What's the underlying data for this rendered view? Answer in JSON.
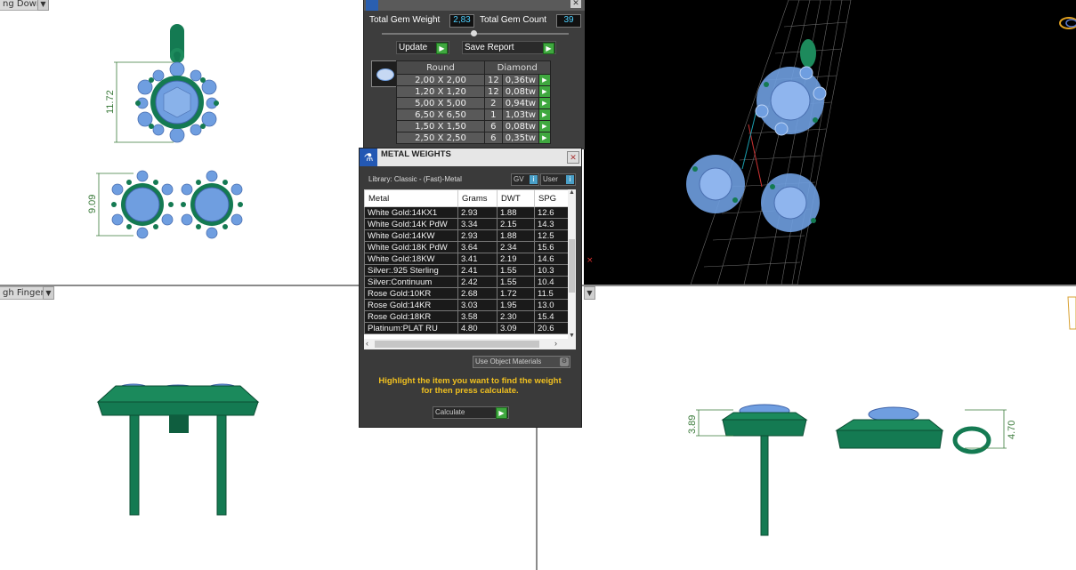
{
  "viewports": {
    "top_left_label": "ng Down",
    "bottom_left_label": "gh Finger"
  },
  "dimensions": {
    "pendant_height": "11.72",
    "earring_height": "9.09",
    "earring_side_height": "3.89",
    "pendant_side_height": "4.70"
  },
  "gem_reporter": {
    "total_weight_label": "Total Gem Weight",
    "total_weight_value": "2,83",
    "total_count_label": "Total Gem Count",
    "total_count_value": "39",
    "update_label": "Update",
    "save_report_label": "Save Report",
    "shape_header": "Round",
    "type_header": "Diamond",
    "rows": [
      {
        "size": "2,00 X 2,00",
        "count": "12",
        "weight": "0,36tw"
      },
      {
        "size": "1,20 X 1,20",
        "count": "12",
        "weight": "0,08tw"
      },
      {
        "size": "5,00 X 5,00",
        "count": "2",
        "weight": "0,94tw"
      },
      {
        "size": "6,50 X 6,50",
        "count": "1",
        "weight": "1,03tw"
      },
      {
        "size": "1,50 X 1,50",
        "count": "6",
        "weight": "0,08tw"
      },
      {
        "size": "2,50 X 2,50",
        "count": "6",
        "weight": "0,35tw"
      }
    ]
  },
  "metal_weights": {
    "title": "METAL WEIGHTS",
    "library": "Library: Classic - (Fast)-Metal",
    "gv_label": "GV",
    "user_label": "User",
    "columns": [
      "Metal",
      "Grams",
      "DWT",
      "SPG"
    ],
    "rows": [
      [
        "White Gold:14KX1",
        "2.93",
        "1.88",
        "12.6"
      ],
      [
        "White Gold:14K PdW",
        "3.34",
        "2.15",
        "14.3"
      ],
      [
        "White Gold:14KW",
        "2.93",
        "1.88",
        "12.5"
      ],
      [
        "White Gold:18K PdW",
        "3.64",
        "2.34",
        "15.6"
      ],
      [
        "White Gold:18KW",
        "3.41",
        "2.19",
        "14.6"
      ],
      [
        "Silver:.925 Sterling",
        "2.41",
        "1.55",
        "10.3"
      ],
      [
        "Silver:Continuum",
        "2.42",
        "1.55",
        "10.4"
      ],
      [
        "Rose Gold:10KR",
        "2.68",
        "1.72",
        "11.5"
      ],
      [
        "Rose Gold:14KR",
        "3.03",
        "1.95",
        "13.0"
      ],
      [
        "Rose Gold:18KR",
        "3.58",
        "2.30",
        "15.4"
      ],
      [
        "Platinum:PLAT RU",
        "4.80",
        "3.09",
        "20.6"
      ]
    ],
    "use_object_materials": "Use Object Materials",
    "instruction": "Highlight the item you want to find the weight for then press calculate.",
    "calculate_label": "Calculate"
  },
  "colors": {
    "metal": "#147a52",
    "gem": "#6f9ee0",
    "panel": "#3b3b3b",
    "button_green": "#3fa83f"
  }
}
